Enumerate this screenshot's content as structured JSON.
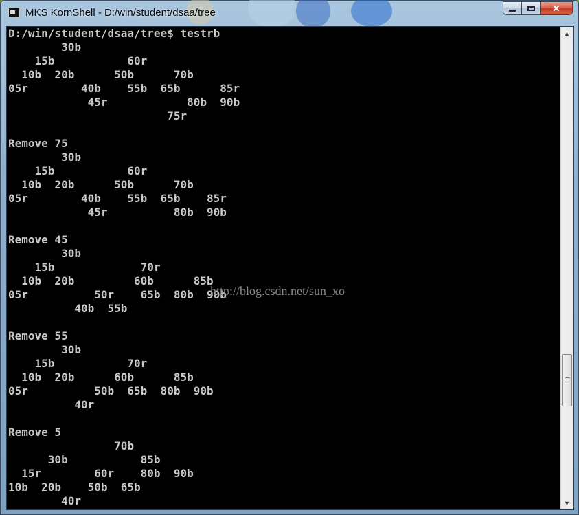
{
  "window": {
    "title": "MKS KornShell - D:/win/student/dsaa/tree",
    "icon": "console-icon",
    "controls": {
      "minimize": "minimize-icon",
      "maximize": "maximize-icon",
      "close": "close-icon"
    }
  },
  "console": {
    "lines": [
      "D:/win/student/dsaa/tree$ testrb",
      "        30b",
      "    15b           60r",
      "  10b  20b      50b      70b",
      "05r        40b    55b  65b      85r",
      "            45r            80b  90b",
      "                        75r",
      "",
      "Remove 75",
      "        30b",
      "    15b           60r",
      "  10b  20b      50b      70b",
      "05r        40b    55b  65b    85r",
      "            45r          80b  90b",
      "",
      "Remove 45",
      "        30b",
      "    15b             70r",
      "  10b  20b         60b      85b",
      "05r          50r    65b  80b  90b",
      "          40b  55b",
      "",
      "Remove 55",
      "        30b",
      "    15b           70r",
      "  10b  20b      60b      85b",
      "05r          50b  65b  80b  90b",
      "          40r",
      "",
      "Remove 5",
      "                70b",
      "      30b           85b",
      "  15r        60r    80b  90b",
      "10b  20b    50b  65b",
      "        40r"
    ]
  },
  "watermark": "http://blog.csdn.net/sun_xo",
  "scrollbar": {
    "up": "scroll-up-arrow-icon",
    "down": "scroll-down-arrow-icon"
  }
}
